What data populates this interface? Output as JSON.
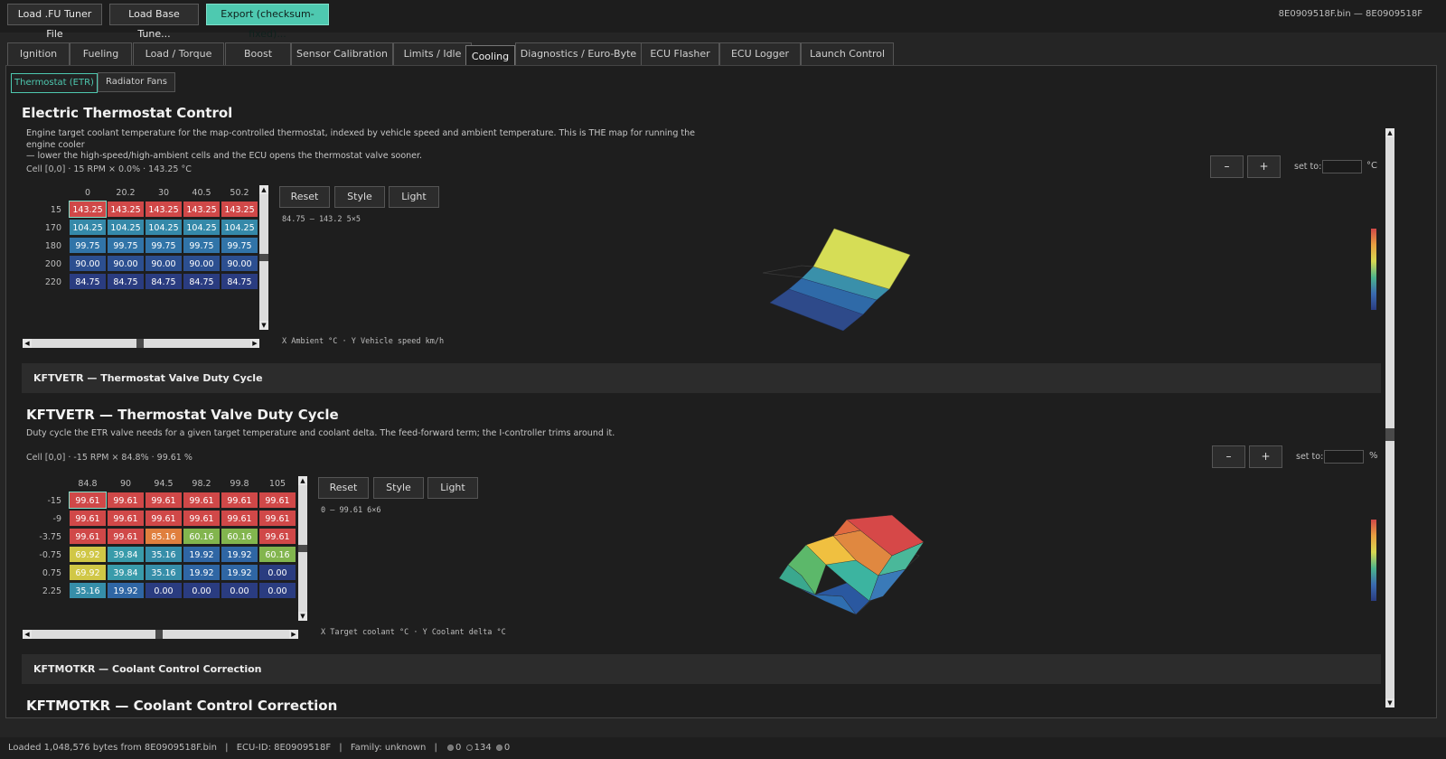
{
  "toolbar": {
    "load_fu": "Load .FU Tuner File",
    "load_base": "Load Base Tune...",
    "export": "Export (checksum-fixed)...",
    "file_info": "8E0909518F.bin — 8E0909518F",
    "accent_color": "#4ec9b0"
  },
  "tabs": [
    "Ignition",
    "Fueling",
    "Load / Torque",
    "Boost",
    "Sensor Calibration",
    "Limits / Idle",
    "Cooling",
    "Diagnostics / Euro-Byte",
    "ECU Flasher",
    "ECU Logger",
    "Launch Control"
  ],
  "active_tab": "Cooling",
  "subtabs": [
    "Thermostat (ETR)",
    "Radiator Fans"
  ],
  "active_subtab": "Thermostat (ETR)",
  "map1": {
    "title": "Electric Thermostat Control",
    "description_line1": "Engine target coolant temperature for the map-controlled thermostat, indexed by vehicle speed and ambient temperature. This is THE map for running the engine cooler",
    "description_line2": "— lower the high-speed/high-ambient cells and the ECU opens the thermostat valve sooner.",
    "cell_info": "Cell [0,0]  ·  15 RPM × 0.0%  ·  143.25 °C",
    "col_headers": [
      "0",
      "20.2",
      "30",
      "40.5",
      "50.2"
    ],
    "row_headers": [
      "15",
      "170",
      "180",
      "200",
      "220"
    ],
    "rows": [
      [
        "143.25",
        "143.25",
        "143.25",
        "143.25",
        "143.25"
      ],
      [
        "104.25",
        "104.25",
        "104.25",
        "104.25",
        "104.25"
      ],
      [
        "99.75",
        "99.75",
        "99.75",
        "99.75",
        "99.75"
      ],
      [
        "90.00",
        "90.00",
        "90.00",
        "90.00",
        "90.00"
      ],
      [
        "84.75",
        "84.75",
        "84.75",
        "84.75",
        "84.75"
      ]
    ],
    "buttons": {
      "reset": "Reset",
      "style": "Style",
      "light": "Light"
    },
    "range": "84.75 – 143.2   5×5",
    "axis_caption": "X Ambient °C · Y Vehicle speed km/h",
    "step_minus": "–",
    "step_plus": "+",
    "set_to": "set to:",
    "unit": "°C"
  },
  "section1": "KFTVETR — Thermostat Valve Duty Cycle",
  "map2": {
    "title": "KFTVETR — Thermostat Valve Duty Cycle",
    "description": "Duty cycle the ETR valve needs for a given target temperature and coolant delta. The feed-forward term; the I-controller trims around it.",
    "cell_info": "Cell [0,0]  ·  -15 RPM × 84.8%  ·  99.61 %",
    "col_headers": [
      "84.8",
      "90",
      "94.5",
      "98.2",
      "99.8",
      "105"
    ],
    "row_headers": [
      "-15",
      "-9",
      "-3.75",
      "-0.75",
      "0.75",
      "2.25"
    ],
    "rows": [
      [
        "99.61",
        "99.61",
        "99.61",
        "99.61",
        "99.61",
        "99.61"
      ],
      [
        "99.61",
        "99.61",
        "99.61",
        "99.61",
        "99.61",
        "99.61"
      ],
      [
        "99.61",
        "99.61",
        "85.16",
        "60.16",
        "60.16",
        "99.61"
      ],
      [
        "69.92",
        "39.84",
        "35.16",
        "19.92",
        "19.92",
        "60.16"
      ],
      [
        "69.92",
        "39.84",
        "35.16",
        "19.92",
        "19.92",
        "0.00"
      ],
      [
        "35.16",
        "19.92",
        "0.00",
        "0.00",
        "0.00",
        "0.00"
      ]
    ],
    "buttons": {
      "reset": "Reset",
      "style": "Style",
      "light": "Light"
    },
    "range": "0 – 99.61   6×6",
    "axis_caption": "X Target coolant °C · Y Coolant delta °C",
    "step_minus": "–",
    "step_plus": "+",
    "set_to": "set to:",
    "unit": "%"
  },
  "section2": "KFTMOTKR — Coolant Control Correction",
  "map3_title": "KFTMOTKR — Coolant Control Correction",
  "status": {
    "loaded": "Loaded 1,048,576 bytes from 8E0909518F.bin",
    "ecu_id": "ECU-ID: 8E0909518F",
    "family": "Family: unknown",
    "count1": "0",
    "count2": "134",
    "count3": "0"
  }
}
